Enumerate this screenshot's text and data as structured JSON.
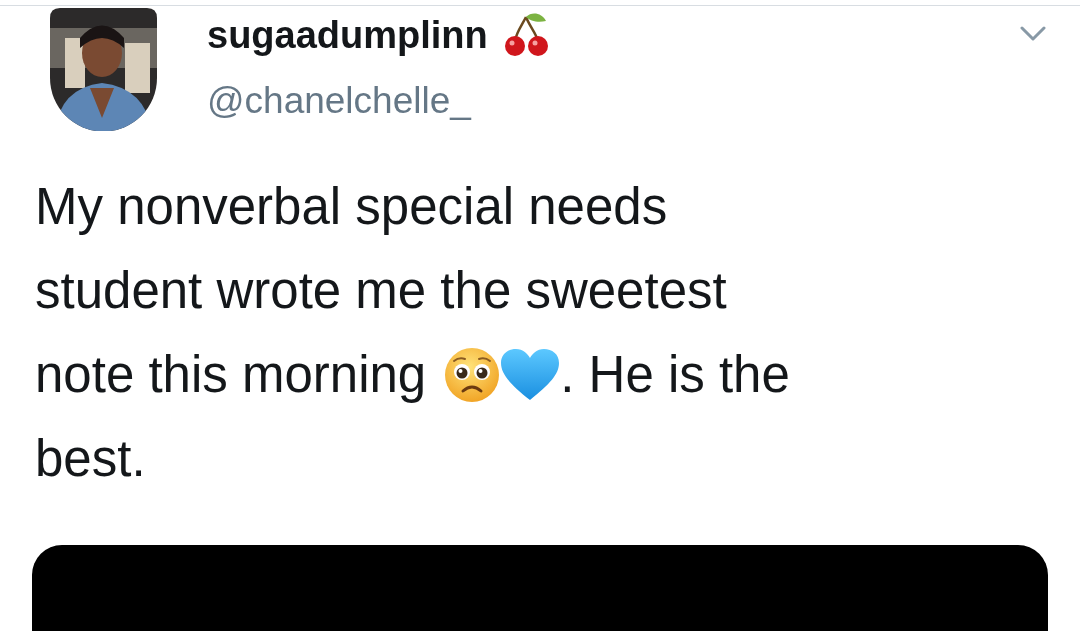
{
  "author": {
    "name": "sugaadumplinn",
    "handle": "@chanelchelle_"
  },
  "tweet": {
    "lines": [
      {
        "segments": [
          {
            "kind": "text",
            "text": "My nonverbal special needs"
          }
        ]
      },
      {
        "segments": [
          {
            "kind": "text",
            "text": "student wrote me the sweetest"
          }
        ]
      },
      {
        "segments": [
          {
            "kind": "text",
            "text": "note this morning"
          },
          {
            "kind": "pleading"
          },
          {
            "kind": "heart"
          },
          {
            "kind": "text",
            "text": ". He is the"
          }
        ]
      },
      {
        "segments": [
          {
            "kind": "text",
            "text": "best."
          }
        ]
      }
    ]
  }
}
